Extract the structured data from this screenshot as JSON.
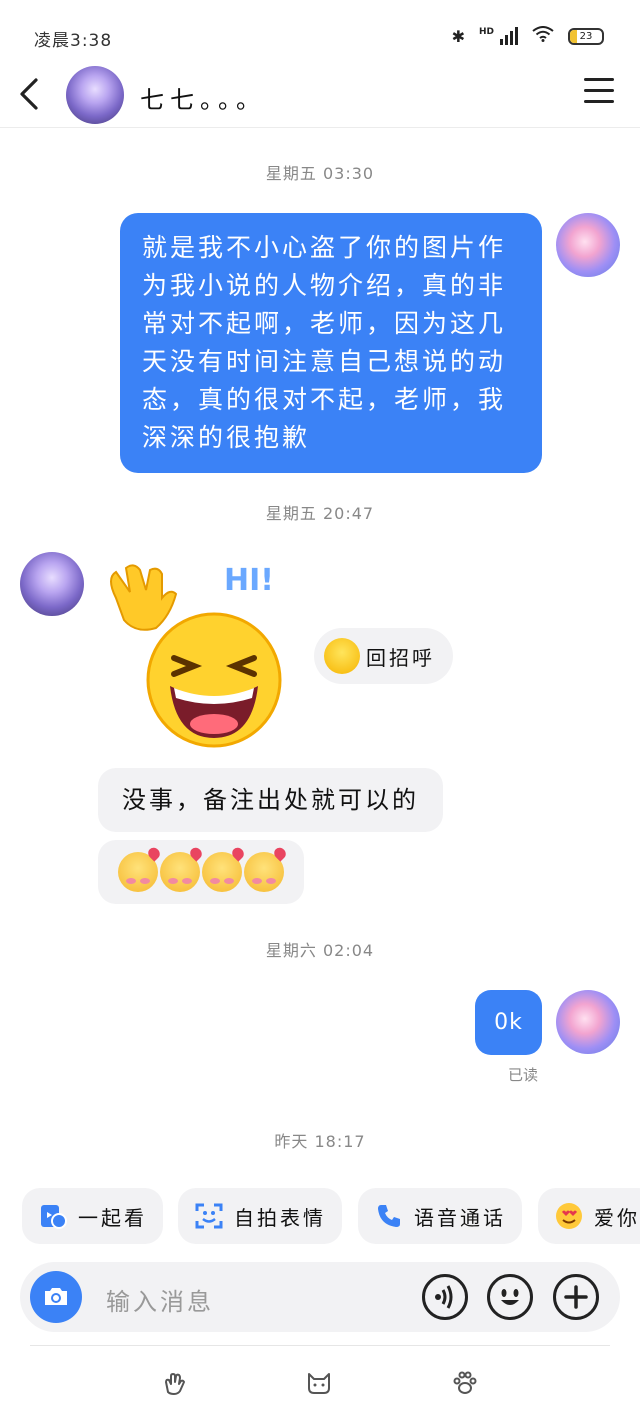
{
  "status_bar": {
    "time": "凌晨3:38",
    "network_label": "HD",
    "battery": "23",
    "battery_level": 0.23,
    "icons": [
      "bluetooth-icon",
      "signal-icon",
      "wifi-icon",
      "battery-icon"
    ]
  },
  "header": {
    "contact_name": "七七。。。",
    "back_icon": "chevron-left-icon",
    "menu_icon": "hamburger-menu-icon"
  },
  "conversation": {
    "timestamp_1": "星期五 03:30",
    "message_1": "就是我不小心盗了你的图片作为我小说的人物介绍，真的非常对不起啊，老师，因为这几天没有时间注意自己想说的动态，真的很对不起，老师，我深深的很抱歉",
    "timestamp_2": "星期五 20:47",
    "sticker": "HI!",
    "greet_reply_label": "回招呼",
    "message_2": "没事，备注出处就可以的",
    "message_3_emojis": "🥰🥰🥰🥰",
    "timestamp_3": "星期六 02:04",
    "message_4": "0k",
    "read_status": "已读",
    "timestamp_4": "昨天 18:17"
  },
  "quick_actions": [
    {
      "label": "一起看",
      "icon": "watch-together-icon"
    },
    {
      "label": "自拍表情",
      "icon": "selfie-sticker-icon"
    },
    {
      "label": "语音通话",
      "icon": "phone-icon"
    },
    {
      "label": "爱你",
      "icon": "heart-eyes-icon"
    }
  ],
  "input_bar": {
    "placeholder": "输入消息",
    "icons": [
      "camera-icon",
      "voice-icon",
      "emoji-icon",
      "plus-icon"
    ]
  },
  "bottom_nav": {
    "icons": [
      "clap-icon",
      "cat-icon",
      "paw-icon"
    ]
  },
  "colors": {
    "accent": "#3b82f6",
    "bubble_in": "#f2f2f4",
    "timestamp": "#888888"
  }
}
